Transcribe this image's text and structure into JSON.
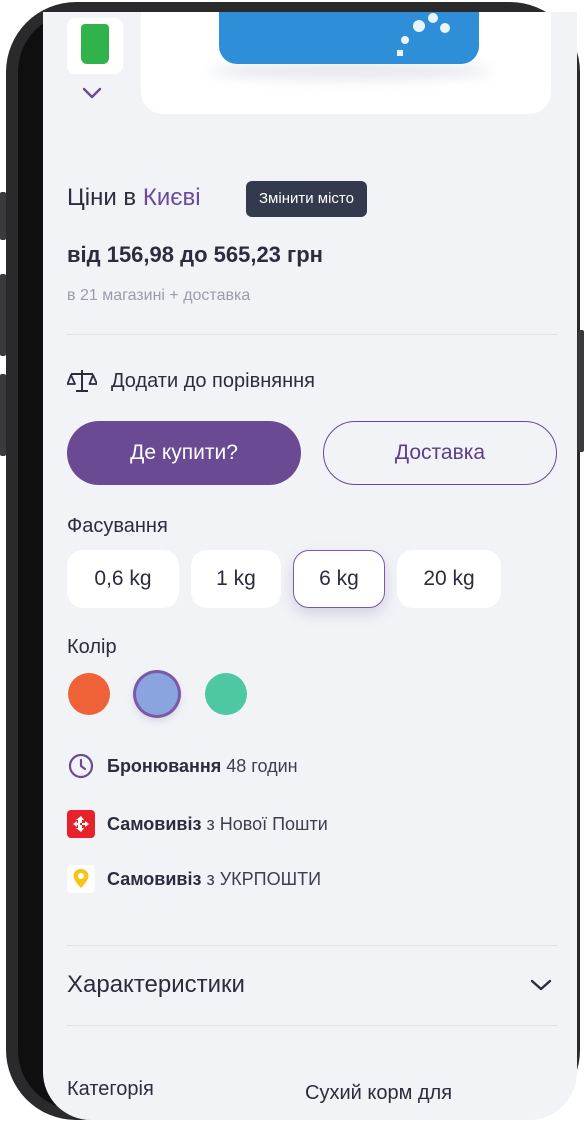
{
  "gallery": {
    "thumbnail_icon": "product-thumbnail",
    "expand_icon": "chevron-down-icon",
    "photo_icon": "product-photo"
  },
  "prices": {
    "city_prefix": "Ціни в",
    "city_name": "Києві",
    "change_city_label": "Змінити місто",
    "range": "від 156,98 до 565,23 грн",
    "shops_info": "в 21 магазині + доставка"
  },
  "compare": {
    "label": "Додати до порівняння",
    "icon": "scales-icon"
  },
  "actions": {
    "where_to_buy": "Де купити?",
    "delivery": "Доставка"
  },
  "packaging": {
    "title": "Фасування",
    "options": [
      "0,6 kg",
      "1 kg",
      "6 kg",
      "20 kg"
    ],
    "selected": "6 kg"
  },
  "color": {
    "title": "Колір",
    "swatches": [
      "#ef6136",
      "#89a4df",
      "#4ec7a3"
    ],
    "selected_index": 1
  },
  "services": [
    {
      "icon": "clock-icon",
      "strong": "Бронювання",
      "rest": "48 годин"
    },
    {
      "icon": "nova-poshta-icon",
      "strong": "Самовивіз",
      "rest": "з Нової Пошти"
    },
    {
      "icon": "ukrposhta-icon",
      "strong": "Самовивіз",
      "rest": "з УКРПОШТИ"
    }
  ],
  "specs": {
    "title": "Характеристики",
    "expand_icon": "chevron-down-icon"
  },
  "category": {
    "label": "Категорія",
    "value": "Сухий корм для"
  },
  "colors": {
    "accent": "#6a4a92",
    "background": "#f2f3f7",
    "tooltip": "#343a4d"
  }
}
